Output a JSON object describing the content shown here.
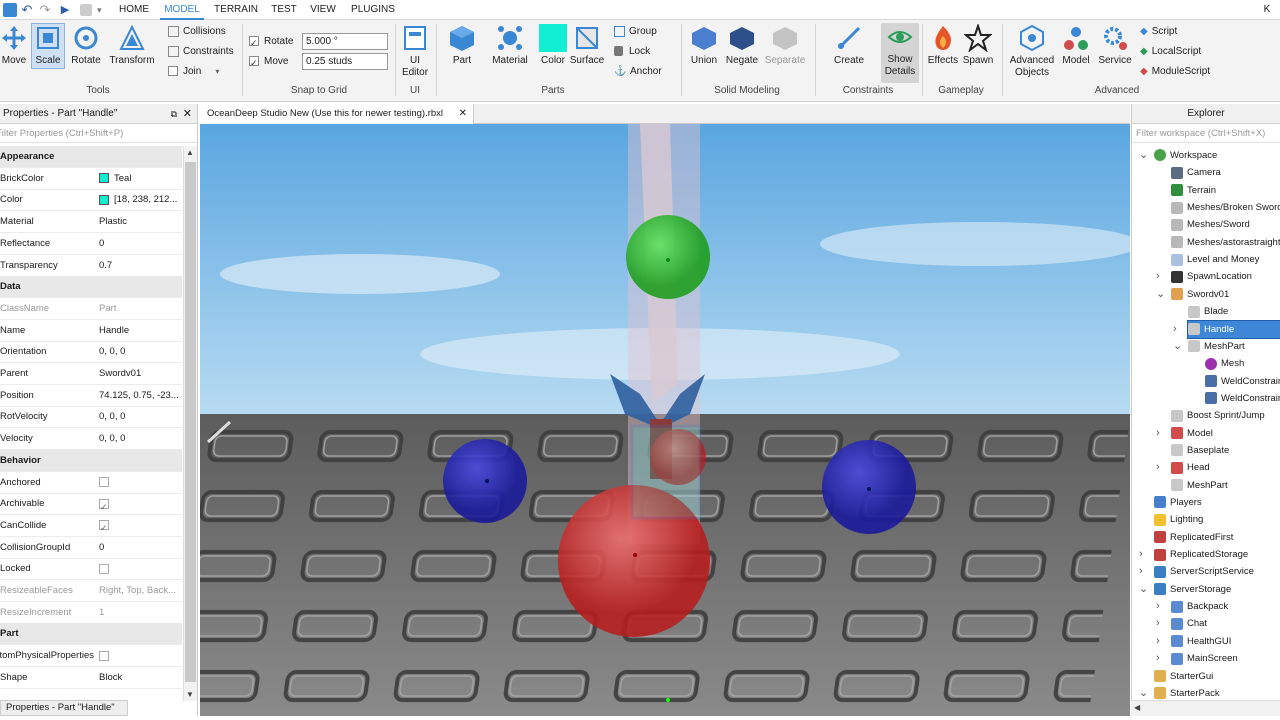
{
  "menu": {
    "tabs": [
      "HOME",
      "MODEL",
      "TERRAIN",
      "TEST",
      "VIEW",
      "PLUGINS"
    ],
    "active": "MODEL",
    "user_initial": "K"
  },
  "ribbon": {
    "tools": {
      "buttons": [
        "Move",
        "Scale",
        "Rotate",
        "Transform"
      ],
      "label": "Tools"
    },
    "collide": {
      "collisions": "Collisions",
      "constraints": "Constraints",
      "join": "Join"
    },
    "snap": {
      "rotate_label": "Rotate",
      "rotate_value": "5.000 °",
      "move_label": "Move",
      "move_value": "0.25 studs",
      "label": "Snap to Grid"
    },
    "ui": {
      "button": "UI Editor",
      "label": "UI"
    },
    "parts": {
      "buttons": [
        "Part",
        "Material",
        "Color",
        "Surface"
      ],
      "group": "Group",
      "lock": "Lock",
      "anchor": "Anchor",
      "label": "Parts"
    },
    "solid": {
      "buttons": [
        "Union",
        "Negate",
        "Separate"
      ],
      "label": "Solid Modeling"
    },
    "constraints": {
      "buttons": [
        "Create",
        "Show Details"
      ],
      "label": "Constraints"
    },
    "gameplay": {
      "buttons": [
        "Effects",
        "Spawn"
      ],
      "label": "Gameplay"
    },
    "advanced": {
      "buttons": [
        "Advanced Objects",
        "Model",
        "Service"
      ],
      "scripts": [
        "Script",
        "LocalScript",
        "ModuleScript"
      ],
      "label": "Advanced"
    }
  },
  "properties": {
    "title": "Properties - Part \"Handle\"",
    "filter": "Filter Properties (Ctrl+Shift+P)",
    "rows": [
      {
        "name": "Appearance",
        "value": "",
        "type": "cat"
      },
      {
        "name": "BrickColor",
        "value": "Teal",
        "type": "swatch"
      },
      {
        "name": "Color",
        "value": "[18, 238, 212...",
        "type": "swatch"
      },
      {
        "name": "Material",
        "value": "Plastic"
      },
      {
        "name": "Reflectance",
        "value": "0"
      },
      {
        "name": "Transparency",
        "value": "0.7"
      },
      {
        "name": "Data",
        "value": "",
        "type": "cat"
      },
      {
        "name": "ClassName",
        "value": "Part",
        "type": "gray"
      },
      {
        "name": "Name",
        "value": "Handle"
      },
      {
        "name": "Orientation",
        "value": "0, 0, 0"
      },
      {
        "name": "Parent",
        "value": "Swordv01"
      },
      {
        "name": "Position",
        "value": "74.125, 0.75, -23..."
      },
      {
        "name": "RotVelocity",
        "value": "0, 0, 0"
      },
      {
        "name": "Velocity",
        "value": "0, 0, 0"
      },
      {
        "name": "Behavior",
        "value": "",
        "type": "cat"
      },
      {
        "name": "Anchored",
        "value": "",
        "type": "cb"
      },
      {
        "name": "Archivable",
        "value": "",
        "type": "cbon"
      },
      {
        "name": "CanCollide",
        "value": "",
        "type": "cbon"
      },
      {
        "name": "CollisionGroupId",
        "value": "0"
      },
      {
        "name": "Locked",
        "value": "",
        "type": "cb"
      },
      {
        "name": "ResizeableFaces",
        "value": "Right, Top, Back...",
        "type": "gray"
      },
      {
        "name": "ResizeIncrement",
        "value": "1",
        "type": "gray"
      },
      {
        "name": "Part",
        "value": "",
        "type": "cat"
      },
      {
        "name": "CustomPhysicalProperties",
        "value": "",
        "type": "cb"
      },
      {
        "name": "Shape",
        "value": "Block"
      }
    ],
    "footer": "Properties - Part \"Handle\""
  },
  "viewport": {
    "tab": "OceanDeep Studio New (Use this for newer testing).rbxl"
  },
  "explorer": {
    "title": "Explorer",
    "filter": "Filter workspace (Ctrl+Shift+X)",
    "items": [
      {
        "label": "Workspace",
        "icon": "globe-icon",
        "color": "#4aa14a",
        "indent": 0,
        "arrow": "down"
      },
      {
        "label": "Camera",
        "icon": "camera-icon",
        "color": "#5a6b82",
        "indent": 1,
        "arrow": ""
      },
      {
        "label": "Terrain",
        "icon": "terrain-icon",
        "color": "#2f8f3a",
        "indent": 1,
        "arrow": ""
      },
      {
        "label": "Meshes/Broken Sword",
        "icon": "mesh-icon",
        "color": "#b8b8b8",
        "indent": 1,
        "arrow": ""
      },
      {
        "label": "Meshes/Sword",
        "icon": "mesh-icon",
        "color": "#b8b8b8",
        "indent": 1,
        "arrow": ""
      },
      {
        "label": "Meshes/astorastraight",
        "icon": "mesh-icon",
        "color": "#b8b8b8",
        "indent": 1,
        "arrow": ""
      },
      {
        "label": "Level and Money",
        "icon": "folder-icon",
        "color": "#a9bfe0",
        "indent": 1,
        "arrow": ""
      },
      {
        "label": "SpawnLocation",
        "icon": "spawn-icon",
        "color": "#333333",
        "indent": 1,
        "arrow": "right"
      },
      {
        "label": "Swordv01",
        "icon": "tool-icon",
        "color": "#e0a050",
        "indent": 1,
        "arrow": "down"
      },
      {
        "label": "Blade",
        "icon": "part-icon",
        "color": "#c8c8c8",
        "indent": 2,
        "arrow": ""
      },
      {
        "label": "Handle",
        "icon": "part-icon",
        "color": "#c8c8c8",
        "indent": 2,
        "arrow": "right",
        "selected": true
      },
      {
        "label": "MeshPart",
        "icon": "part-icon",
        "color": "#c8c8c8",
        "indent": 2,
        "arrow": "down"
      },
      {
        "label": "Mesh",
        "icon": "mesh-icon",
        "color": "#9b2fae",
        "indent": 3,
        "arrow": ""
      },
      {
        "label": "WeldConstraint",
        "icon": "weld-icon",
        "color": "#4a6ea8",
        "indent": 3,
        "arrow": ""
      },
      {
        "label": "WeldConstraint",
        "icon": "weld-icon",
        "color": "#4a6ea8",
        "indent": 3,
        "arrow": ""
      },
      {
        "label": "Boost Sprint/Jump",
        "icon": "part-icon",
        "color": "#c8c8c8",
        "indent": 1,
        "arrow": ""
      },
      {
        "label": "Model",
        "icon": "model-icon",
        "color": "#d14b4b",
        "indent": 1,
        "arrow": "right"
      },
      {
        "label": "Baseplate",
        "icon": "part-icon",
        "color": "#c8c8c8",
        "indent": 1,
        "arrow": ""
      },
      {
        "label": "Head",
        "icon": "model-icon",
        "color": "#d14b4b",
        "indent": 1,
        "arrow": "right"
      },
      {
        "label": "MeshPart",
        "icon": "part-icon",
        "color": "#c8c8c8",
        "indent": 1,
        "arrow": ""
      },
      {
        "label": "Players",
        "icon": "players-icon",
        "color": "#4a7fd0",
        "indent": 0,
        "arrow": ""
      },
      {
        "label": "Lighting",
        "icon": "lighting-icon",
        "color": "#f0c030",
        "indent": 0,
        "arrow": ""
      },
      {
        "label": "ReplicatedFirst",
        "icon": "service-icon",
        "color": "#c04040",
        "indent": 0,
        "arrow": ""
      },
      {
        "label": "ReplicatedStorage",
        "icon": "service-icon",
        "color": "#c04040",
        "indent": 0,
        "arrow": "right"
      },
      {
        "label": "ServerScriptService",
        "icon": "service-icon",
        "color": "#3a7fbf",
        "indent": 0,
        "arrow": "right"
      },
      {
        "label": "ServerStorage",
        "icon": "service-icon",
        "color": "#3a7fbf",
        "indent": 0,
        "arrow": "down"
      },
      {
        "label": "Backpack",
        "icon": "screen-icon",
        "color": "#5a8ad0",
        "indent": 1,
        "arrow": "right"
      },
      {
        "label": "Chat",
        "icon": "screen-icon",
        "color": "#5a8ad0",
        "indent": 1,
        "arrow": "right"
      },
      {
        "label": "HealthGUI",
        "icon": "screen-icon",
        "color": "#5a8ad0",
        "indent": 1,
        "arrow": "right"
      },
      {
        "label": "MainScreen",
        "icon": "screen-icon",
        "color": "#5a8ad0",
        "indent": 1,
        "arrow": "right"
      },
      {
        "label": "StarterGui",
        "icon": "folder-icon",
        "color": "#e0b050",
        "indent": 0,
        "arrow": ""
      },
      {
        "label": "StarterPack",
        "icon": "folder-icon",
        "color": "#e0b050",
        "indent": 0,
        "arrow": "down"
      }
    ]
  }
}
